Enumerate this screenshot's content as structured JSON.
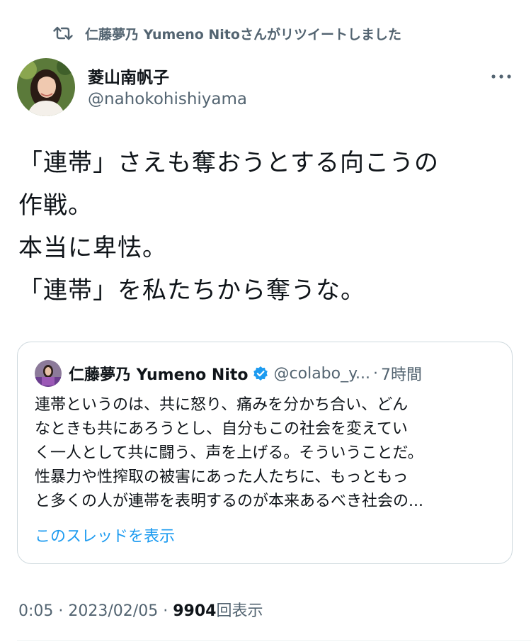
{
  "retweet": {
    "text": "仁藤夢乃  Yumeno Nitoさんがリツイートしました",
    "icon": "retweet-icon"
  },
  "author": {
    "name": "菱山南帆子",
    "handle": "@nahokohishiyama",
    "avatar_icon": "profile-photo"
  },
  "tweet": {
    "lines": [
      "「連帯」さえも奪おうとする向こうの",
      "作戦。",
      "本当に卑怯。",
      "「連帯」を私たちから奪うな。"
    ]
  },
  "quote": {
    "name": "仁藤夢乃  Yumeno Nito",
    "handle": "@colabo_y...",
    "separator": "·",
    "time": "7時間",
    "verified_icon": "verified-badge-icon",
    "lines": [
      "連帯というのは、共に怒り、痛みを分かち合い、どん",
      "なときも共にあろうとし、自分もこの社会を変えてい",
      "く一人として共に闘う、声を上げる。そういうことだ。",
      "性暴力や性搾取の被害にあった人たちに、もっともっ",
      "と多くの人が連帯を表明するのが本来あるべき社会の..."
    ],
    "show_thread": "このスレッドを表示"
  },
  "meta": {
    "time": "0:05",
    "sep1": "·",
    "date": "2023/02/05",
    "sep2": "·",
    "views_count": "9904",
    "views_label": "回表示"
  },
  "colors": {
    "text": "#0f1419",
    "secondary": "#536471",
    "link": "#1d9bf0",
    "border": "#cfd9de"
  }
}
